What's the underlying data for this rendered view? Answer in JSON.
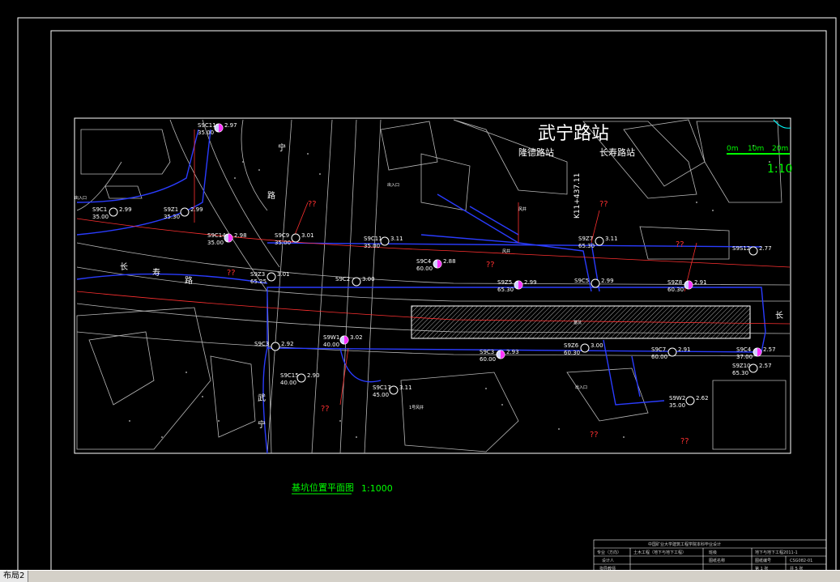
{
  "drawing": {
    "station_title": "武宁路站",
    "road_labels": {
      "north_left": "宁",
      "north_left2": "路",
      "west_1": "长",
      "west_2": "寿",
      "west_3": "路",
      "south_1": "武",
      "south_2": "宁",
      "east": "长",
      "diag": "武宁路"
    },
    "nearby_stations": [
      "隆德路站",
      "长寿路站"
    ],
    "vertical_note": "K11+437.11",
    "scale_bar": {
      "ticks": [
        "0m",
        "10m",
        "20m"
      ],
      "ratio": "1:10"
    },
    "plan_caption": "基坑位置平面图",
    "plan_scale": "1:1000",
    "excavation_label": "基坑",
    "exit_labels": [
      "出入口",
      "出入口",
      "风井",
      "风井",
      "1号风井",
      "出入口"
    ],
    "points": [
      {
        "id": "S9C11",
        "v1": "2.97",
        "v2": "35.00"
      },
      {
        "id": "S9C1",
        "v1": "2.99",
        "v2": "35.00"
      },
      {
        "id": "S9Z1",
        "v1": "2.99",
        "v2": "35.30"
      },
      {
        "id": "S9C14",
        "v1": "2.98",
        "v2": "35.00"
      },
      {
        "id": "S9C9",
        "v1": "3.01",
        "v2": "35.00"
      },
      {
        "id": "S9C11",
        "v1": "3.11",
        "v2": "35.00"
      },
      {
        "id": "S9C4",
        "v1": "2.88",
        "v2": "60.00"
      },
      {
        "id": "S9Z3",
        "v1": "3.01",
        "v2": "65.25"
      },
      {
        "id": "S9C2",
        "v1": "3.00",
        "v2": ""
      },
      {
        "id": "S9Z5",
        "v1": "2.99",
        "v2": "65.30"
      },
      {
        "id": "S9Z7",
        "v1": "3.11",
        "v2": "65.30"
      },
      {
        "id": "S9C5",
        "v1": "2.99",
        "v2": ""
      },
      {
        "id": "S9Z8",
        "v1": "2.91",
        "v2": "60.30"
      },
      {
        "id": "S9S12",
        "v1": "2.77",
        "v2": ""
      },
      {
        "id": "S9C3",
        "v1": "2.92",
        "v2": ""
      },
      {
        "id": "S9W1",
        "v1": "3.02",
        "v2": "40.00"
      },
      {
        "id": "S9C15",
        "v1": "2.90",
        "v2": "40.00"
      },
      {
        "id": "S9C17",
        "v1": "3.11",
        "v2": "45.00"
      },
      {
        "id": "S9C3",
        "v1": "2.93",
        "v2": "60.00"
      },
      {
        "id": "S9Z6",
        "v1": "3.00",
        "v2": "60.30"
      },
      {
        "id": "S9C7",
        "v1": "2.91",
        "v2": "60.00"
      },
      {
        "id": "S9C4",
        "v1": "2.57",
        "v2": "37.00"
      },
      {
        "id": "S9Z10",
        "v1": "2.57",
        "v2": "65.30"
      },
      {
        "id": "S9W2",
        "v1": "2.62",
        "v2": "35.00"
      }
    ],
    "unknown_marks": "??"
  },
  "title_block": {
    "school": "中国矿业大学建筑工程学院本科毕业设计",
    "major_label": "专业（方向）",
    "major_value": "土木工程（地下与地下工程）",
    "class_label": "班级",
    "drawing_no_label": "地下与地下工程2011-1",
    "designer_label": "设计人",
    "drawing_name_label": "图纸名称",
    "drawing_code_label": "图纸编号",
    "drawing_code": "CSG082-01",
    "mentor_label": "指导教师",
    "page": "第 1 张",
    "total": "共 5 张"
  },
  "status_bar": {
    "layout_tab": "布局2"
  }
}
